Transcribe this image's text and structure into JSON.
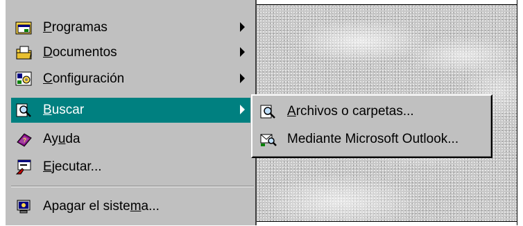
{
  "start_menu": {
    "items": [
      {
        "label_pre": "",
        "label_key": "P",
        "label_post": "rogramas",
        "icon": "programs-folder-icon",
        "has_submenu": true
      },
      {
        "label_pre": "",
        "label_key": "D",
        "label_post": "ocumentos",
        "icon": "documents-folder-icon",
        "has_submenu": true
      },
      {
        "label_pre": "",
        "label_key": "C",
        "label_post": "onfiguración",
        "icon": "settings-icon",
        "has_submenu": true
      },
      {
        "label_pre": "",
        "label_key": "B",
        "label_post": "uscar",
        "icon": "find-magnifier-icon",
        "has_submenu": true,
        "active": true
      },
      {
        "label_pre": "Ay",
        "label_key": "u",
        "label_post": "da",
        "icon": "help-book-icon",
        "has_submenu": false
      },
      {
        "label_pre": "",
        "label_key": "E",
        "label_post": "jecutar...",
        "icon": "run-icon",
        "has_submenu": false
      },
      {
        "label_pre": "Apagar el siste",
        "label_key": "m",
        "label_post": "a...",
        "icon": "shutdown-computer-icon",
        "has_submenu": false
      }
    ]
  },
  "buscar_submenu": {
    "items": [
      {
        "label_pre": "",
        "label_key": "A",
        "label_post": "rchivos o carpetas...",
        "icon": "find-files-icon"
      },
      {
        "label_pre": "",
        "label_key": "",
        "label_post": "Mediante Microsoft Outlook...",
        "icon": "outlook-find-icon"
      }
    ]
  },
  "colors": {
    "highlight": "#008080",
    "menu_bg": "#c0c0c0"
  }
}
